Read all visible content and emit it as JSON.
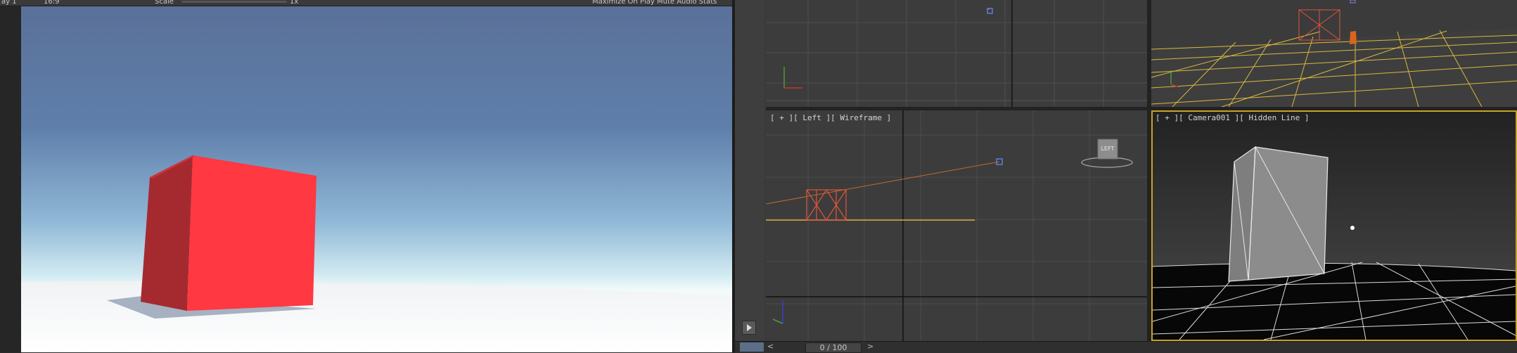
{
  "game_view": {
    "toolbar": {
      "display": "ay 1",
      "aspect": "16:9",
      "scale_label": "Scale",
      "scale_value": "1x",
      "right": "Maximize On Play   Mute Audio   Stats"
    },
    "colors": {
      "sky_top": "#56709a",
      "sky_horizon": "#d8f0f4",
      "ground": "#ffffff",
      "cube_front": "#ff3b45",
      "cube_side": "#a92a30",
      "cube_top": "#e8323b"
    }
  },
  "max": {
    "viewports": {
      "top": {
        "label": ""
      },
      "perspective": {
        "label": ""
      },
      "left": {
        "label": "[ + ][ Left ][ Wireframe ]",
        "viewcube_text": "LEFT"
      },
      "camera": {
        "label": "[ + ][ Camera001 ][ Hidden Line ]"
      }
    },
    "timeline": {
      "frame": "0 / 100",
      "prev": "<",
      "next": ">"
    },
    "colors": {
      "grid": "#555555",
      "wire_red": "#e0533f",
      "wire_orange": "#c8692b",
      "wire_yellow": "#e8c84a",
      "selection_border": "#c9a227",
      "camera_selected": "#5b7fe0"
    }
  }
}
